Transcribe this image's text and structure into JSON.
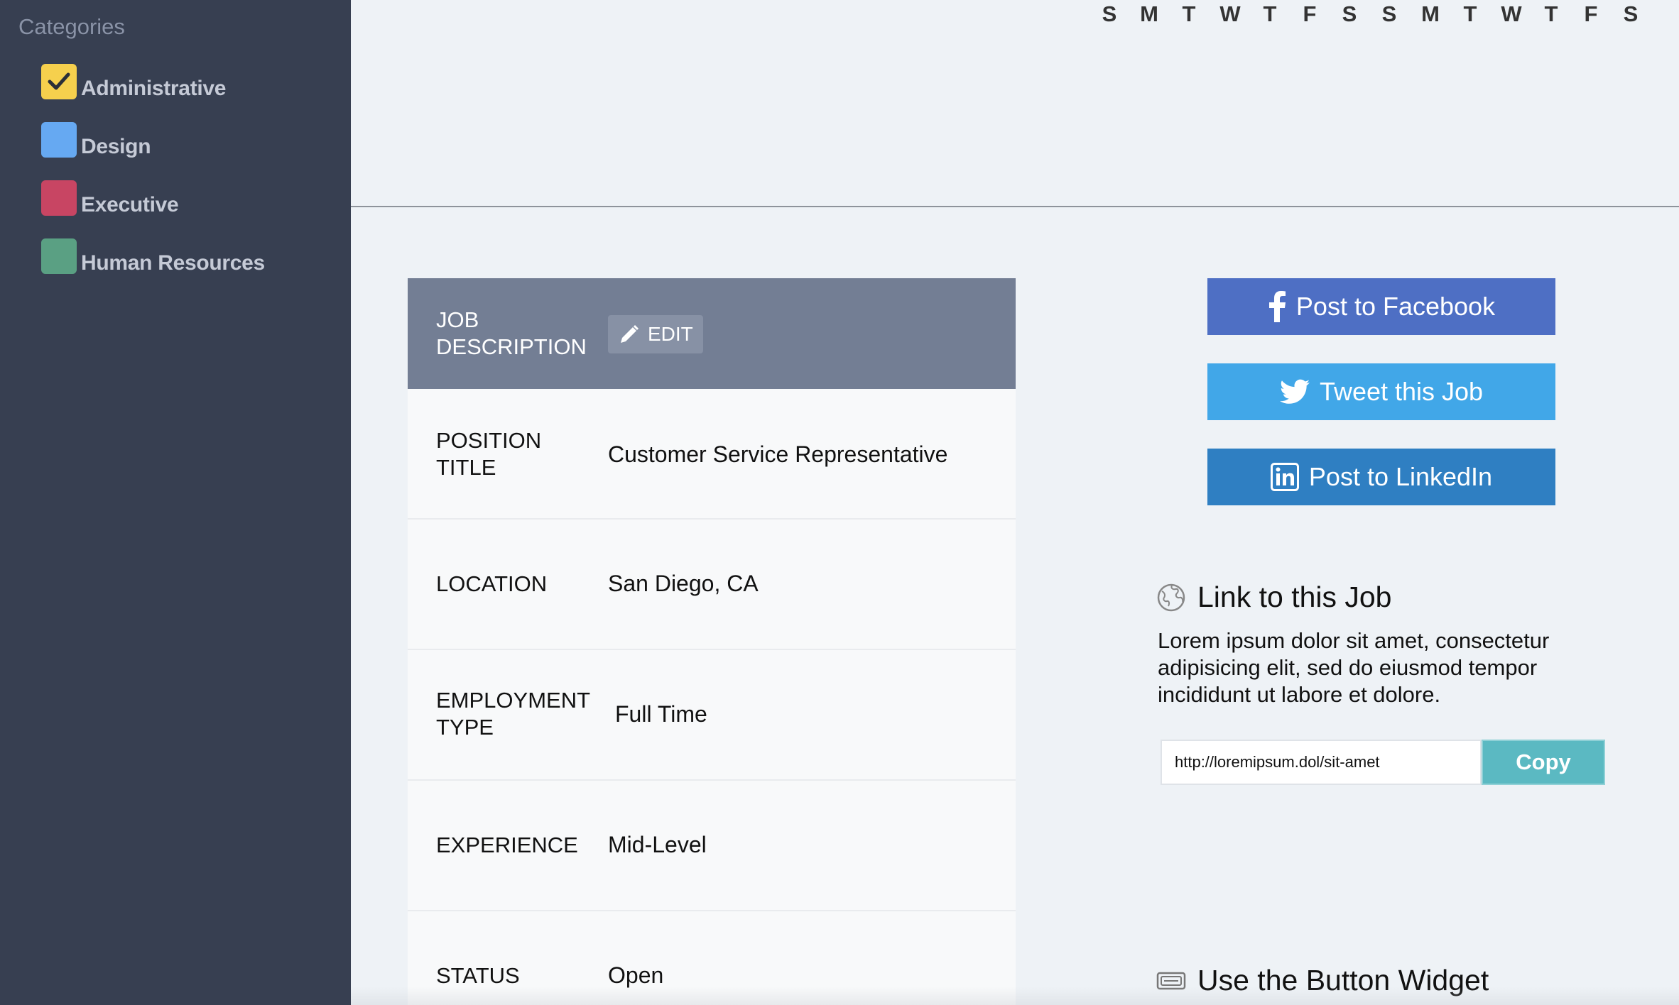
{
  "sidebar": {
    "title": "Categories",
    "items": [
      {
        "label": "Administrative",
        "color": "#f6d04d",
        "checked": true
      },
      {
        "label": "Design",
        "color": "#66a9f2",
        "checked": false
      },
      {
        "label": "Executive",
        "color": "#c84563",
        "checked": false
      },
      {
        "label": "Human Resources",
        "color": "#5aa083",
        "checked": false
      }
    ]
  },
  "calendar": {
    "days": [
      "S",
      "M",
      "T",
      "W",
      "T",
      "F",
      "S",
      "S",
      "M",
      "T",
      "W",
      "T",
      "F",
      "S"
    ]
  },
  "job": {
    "header": "JOB DESCRIPTION",
    "edit_label": "EDIT",
    "rows": [
      {
        "label": "POSITION TITLE",
        "value": "Customer Service Representative"
      },
      {
        "label": "LOCATION",
        "value": "San Diego, CA"
      },
      {
        "label": "EMPLOYMENT TYPE",
        "value": "Full Time"
      },
      {
        "label": "EXPERIENCE",
        "value": "Mid-Level"
      },
      {
        "label": "STATUS",
        "value": "Open"
      }
    ]
  },
  "share": {
    "facebook": "Post to Facebook",
    "twitter": "Tweet this Job",
    "linkedin": "Post to LinkedIn"
  },
  "link_section": {
    "heading": "Link to this Job",
    "description": "Lorem ipsum dolor sit amet, consectetur adipisicing elit, sed do eiusmod tempor incididunt ut labore et dolore.",
    "url": "http://loremipsum.dol/sit-amet",
    "copy_label": "Copy"
  },
  "widget_section": {
    "heading": "Use the Button Widget"
  },
  "colors": {
    "sidebar_bg": "#373f51",
    "job_header_bg": "#737e94",
    "facebook": "#4e6fc4",
    "twitter": "#41a7e8",
    "linkedin": "#2f7fc2",
    "copy": "#5bb9c2"
  }
}
